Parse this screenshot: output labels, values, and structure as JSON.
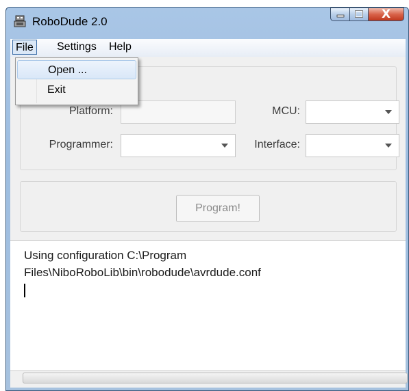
{
  "window": {
    "title": "RoboDude 2.0",
    "close_glyph": "X"
  },
  "menubar": {
    "items": [
      {
        "label": "File"
      },
      {
        "label": "Settings"
      },
      {
        "label": "Help"
      }
    ]
  },
  "file_menu": {
    "items": [
      {
        "label": "Open ..."
      },
      {
        "label": "Exit"
      }
    ]
  },
  "config": {
    "platform_label": "Platform:",
    "platform_value": "",
    "mcu_label": "MCU:",
    "mcu_value": "",
    "programmer_label": "Programmer:",
    "programmer_value": "",
    "interface_label": "Interface:",
    "interface_value": ""
  },
  "actions": {
    "program_label": "Program!"
  },
  "log": {
    "lines": [
      "Using configuration C:\\Program",
      "Files\\NiboRoboLib\\bin\\robodude\\avrdude.conf"
    ]
  },
  "progress": {
    "value": 0
  },
  "icons": {
    "app": "robot-icon",
    "minimize": "minimize-icon",
    "maximize": "maximize-icon",
    "close": "close-icon"
  }
}
